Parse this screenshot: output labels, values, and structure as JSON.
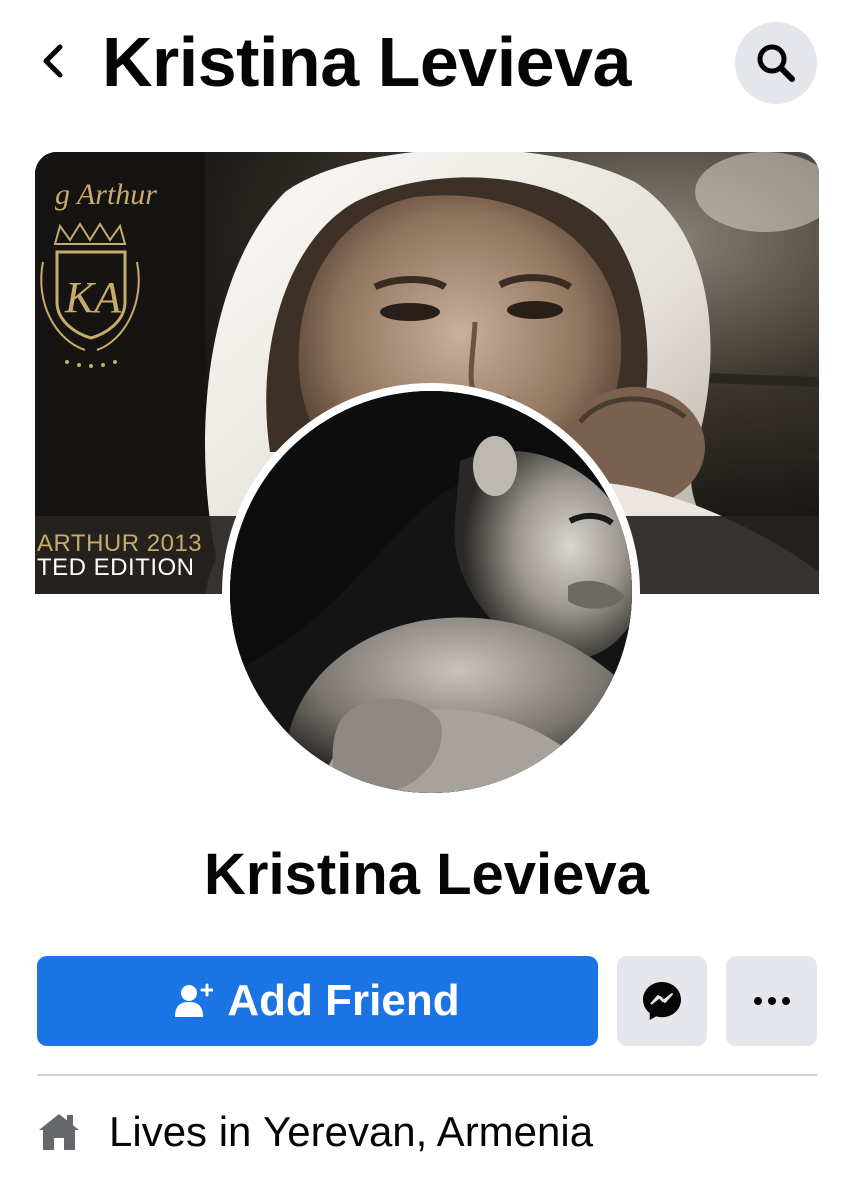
{
  "header": {
    "title": "Kristina Levieva",
    "back_icon": "chevron-left-icon",
    "search_icon": "search-icon"
  },
  "cover": {
    "badge_line1": "ARTHUR 2013",
    "badge_line2": "TED EDITION",
    "logo_text": "g Arthur",
    "logo_monogram": "KA"
  },
  "profile": {
    "name": "Kristina Levieva"
  },
  "actions": {
    "add_friend_label": "Add Friend",
    "add_friend_icon": "add-person-icon",
    "messenger_icon": "messenger-icon",
    "more_icon": "more-dots-icon"
  },
  "intro": {
    "lives_prefix": "Lives in ",
    "lives_place": "Yerevan, Armenia",
    "home_icon": "home-icon"
  },
  "colors": {
    "primary_blue": "#1b74e4",
    "button_gray": "#e4e6eb",
    "text": "#050505",
    "divider": "#ced0d4",
    "cover_gold": "#c6ab6a"
  }
}
